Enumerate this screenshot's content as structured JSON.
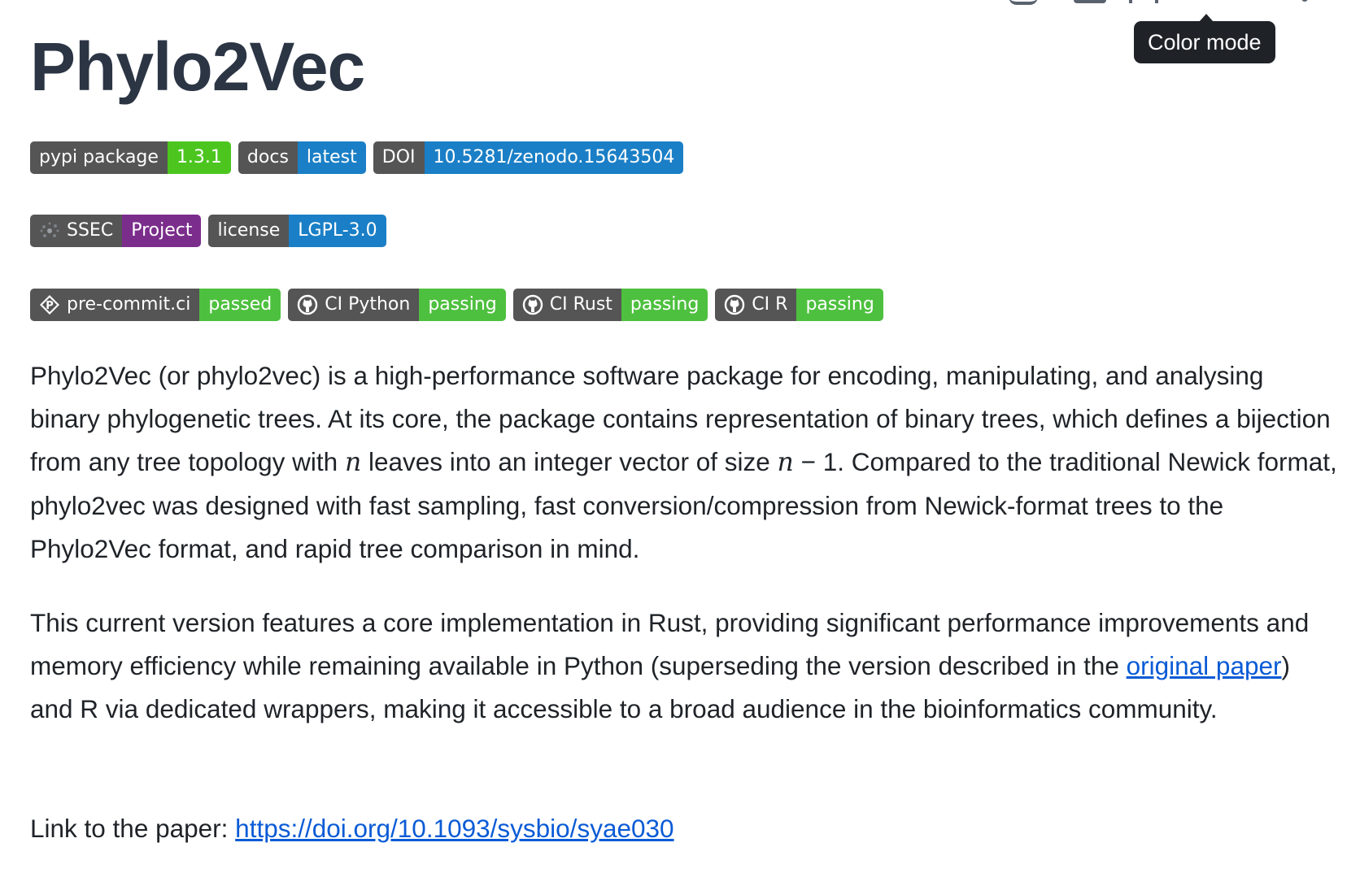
{
  "page": {
    "title": "Phylo2Vec",
    "tooltip": "Color mode"
  },
  "badges": {
    "row1": [
      {
        "label": "pypi package",
        "value": "1.3.1",
        "color": "#4cc61f"
      },
      {
        "label": "docs",
        "value": "latest",
        "color": "#1a7fc6"
      },
      {
        "label": "DOI",
        "value": "10.5281/zenodo.15643504",
        "color": "#1a7fc6"
      }
    ],
    "row2": [
      {
        "label": "SSEC",
        "value": "Project",
        "color": "#7b2d8c",
        "icon": "ssec-logo-icon"
      },
      {
        "label": "license",
        "value": "LGPL-3.0",
        "color": "#1a7fc6"
      }
    ],
    "row3": [
      {
        "label": "pre-commit.ci",
        "value": "passed",
        "color": "#4ec03f",
        "icon": "pre-commit-icon"
      },
      {
        "label": "CI Python",
        "value": "passing",
        "color": "#4ec03f",
        "icon": "github-icon"
      },
      {
        "label": "CI Rust",
        "value": "passing",
        "color": "#4ec03f",
        "icon": "github-icon"
      },
      {
        "label": "CI R",
        "value": "passing",
        "color": "#4ec03f",
        "icon": "github-icon"
      }
    ]
  },
  "intro": {
    "p1_a": "Phylo2Vec (or phylo2vec) is a high-performance software package for encoding, manipulating, and analysing binary phylogenetic trees. At its core, the package contains representation of binary trees, which defines a bijection from any tree topology with ",
    "n1": "n",
    "p1_b": " leaves into an integer vector of size ",
    "n2": "n",
    "p1_c": " − 1. Compared to the traditional Newick format, phylo2vec was designed with fast sampling, fast conversion/compression from Newick-format trees to the Phylo2Vec format, and rapid tree comparison in mind.",
    "p2_a": "This current version features a core implementation in Rust, providing significant performance improvements and memory efficiency while remaining available in Python (superseding the version described in the ",
    "p2_link": "original paper",
    "p2_b": ") and R via dedicated wrappers, making it accessible to a broad audience in the bioinformatics community.",
    "p3_label": "Link to the paper: ",
    "p3_link": "https://doi.org/10.1093/sysbio/syae030"
  },
  "colors": {
    "link": "#0a5bd6",
    "badge_label_bg": "#555555",
    "tooltip_bg": "#1f2328"
  }
}
